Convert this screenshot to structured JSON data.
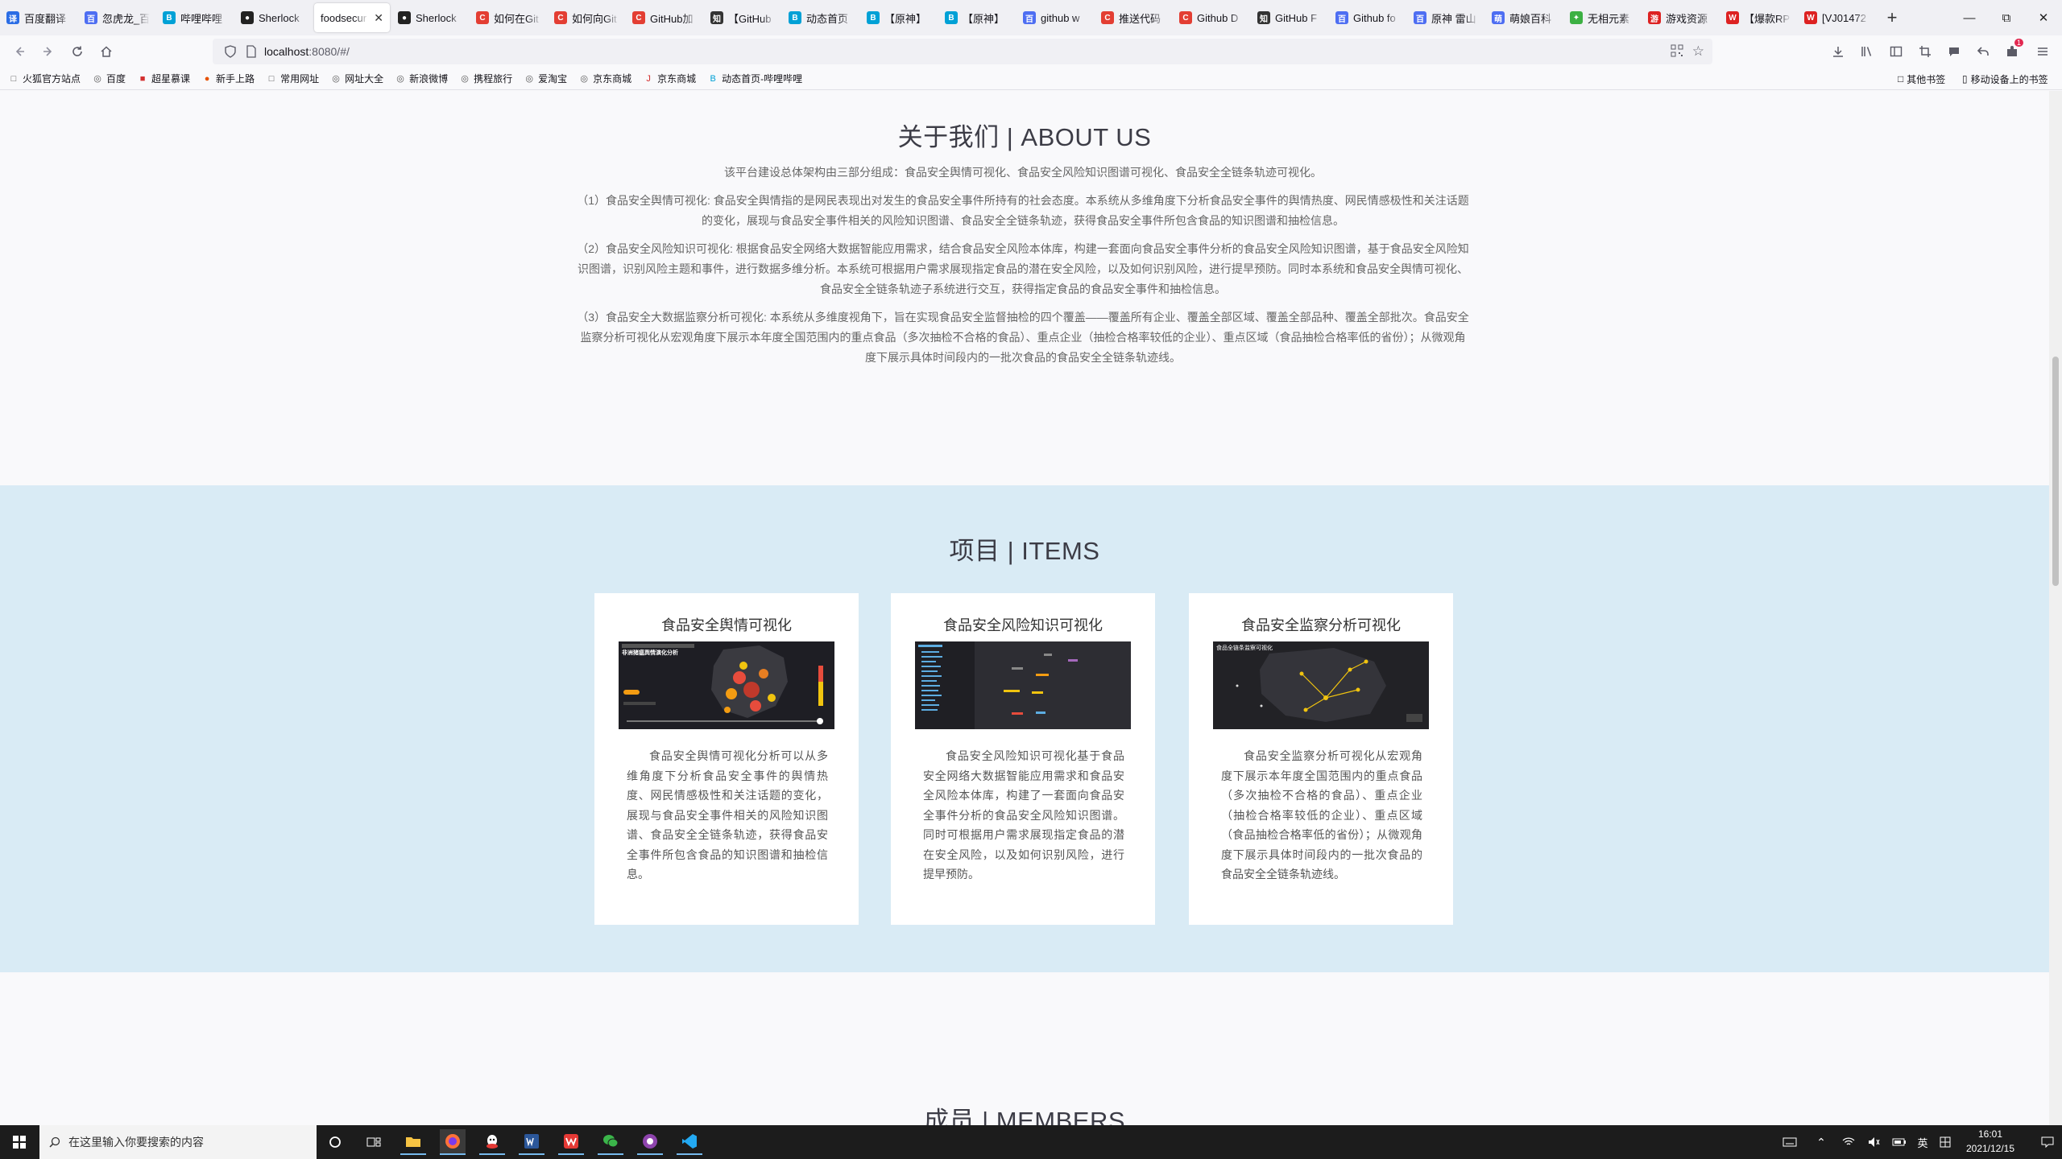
{
  "browser": {
    "tabs": [
      {
        "title": "百度翻译",
        "favicon_color": "#2b6de5",
        "glyph": "译"
      },
      {
        "title": "忽虎龙_百",
        "favicon_color": "#4e6ef2",
        "glyph": "百"
      },
      {
        "title": "哔哩哔哩",
        "favicon_color": "#00a1d6",
        "glyph": "B"
      },
      {
        "title": "Sherlock",
        "favicon_color": "#222222",
        "glyph": "●"
      },
      {
        "title": "foodsecur",
        "favicon_color": "#ffffff",
        "glyph": ""
      },
      {
        "title": "Sherlock",
        "favicon_color": "#222222",
        "glyph": "●"
      },
      {
        "title": "如何在Git",
        "favicon_color": "#e33e33",
        "glyph": "C"
      },
      {
        "title": "如何向Git",
        "favicon_color": "#e33e33",
        "glyph": "C"
      },
      {
        "title": "GitHub加",
        "favicon_color": "#e33e33",
        "glyph": "C"
      },
      {
        "title": "【GitHub",
        "favicon_color": "#333333",
        "glyph": "知"
      },
      {
        "title": "动态首页",
        "favicon_color": "#00a1d6",
        "glyph": "B"
      },
      {
        "title": "【原神】",
        "favicon_color": "#00a1d6",
        "glyph": "B"
      },
      {
        "title": "【原神】",
        "favicon_color": "#00a1d6",
        "glyph": "B"
      },
      {
        "title": "github w",
        "favicon_color": "#4e6ef2",
        "glyph": "百"
      },
      {
        "title": "推送代码",
        "favicon_color": "#e33e33",
        "glyph": "C"
      },
      {
        "title": "Github D",
        "favicon_color": "#e33e33",
        "glyph": "C"
      },
      {
        "title": "GitHub F",
        "favicon_color": "#333333",
        "glyph": "知"
      },
      {
        "title": "Github fo",
        "favicon_color": "#4e6ef2",
        "glyph": "百"
      },
      {
        "title": "原神 雷山",
        "favicon_color": "#4e6ef2",
        "glyph": "百"
      },
      {
        "title": "萌娘百科",
        "favicon_color": "#4e6ef2",
        "glyph": "萌"
      },
      {
        "title": "无相元素",
        "favicon_color": "#3cb043",
        "glyph": "✦"
      },
      {
        "title": "游戏资源",
        "favicon_color": "#d22",
        "glyph": "游"
      },
      {
        "title": "【爆款RP",
        "favicon_color": "#d22",
        "glyph": "W"
      },
      {
        "title": "[VJ01472",
        "favicon_color": "#d22",
        "glyph": "W"
      }
    ],
    "url_host": "localhost",
    "url_path": ":8080/#/",
    "bookmarks": [
      "火狐官方站点",
      "百度",
      "超星慕课",
      "新手上路",
      "常用网址",
      "网址大全",
      "新浪微博",
      "携程旅行",
      "爱淘宝",
      "京东商城",
      "京东商城",
      "动态首页-哔哩哔哩"
    ],
    "bookmarks_right": [
      "其他书签",
      "移动设备上的书签"
    ],
    "notification_badge": "1"
  },
  "about": {
    "title": "关于我们 | ABOUT US",
    "intro": "该平台建设总体架构由三部分组成：食品安全舆情可视化、食品安全风险知识图谱可视化、食品安全全链条轨迹可视化。",
    "p1": "（1）食品安全舆情可视化: 食品安全舆情指的是网民表现出对发生的食品安全事件所持有的社会态度。本系统从多维角度下分析食品安全事件的舆情热度、网民情感极性和关注话题的变化，展现与食品安全事件相关的风险知识图谱、食品安全全链条轨迹，获得食品安全事件所包含食品的知识图谱和抽检信息。",
    "p2": "（2）食品安全风险知识可视化: 根据食品安全网络大数据智能应用需求，结合食品安全风险本体库，构建一套面向食品安全事件分析的食品安全风险知识图谱，基于食品安全风险知识图谱，识别风险主题和事件，进行数据多维分析。本系统可根据用户需求展现指定食品的潜在安全风险，以及如何识别风险，进行提早预防。同时本系统和食品安全舆情可视化、食品安全全链条轨迹子系统进行交互，获得指定食品的食品安全事件和抽检信息。",
    "p3": "（3）食品安全大数据监察分析可视化: 本系统从多维度视角下，旨在实现食品安全监督抽检的四个覆盖——覆盖所有企业、覆盖全部区域、覆盖全部品种、覆盖全部批次。食品安全监察分析可视化从宏观角度下展示本年度全国范围内的重点食品（多次抽检不合格的食品）、重点企业（抽检合格率较低的企业）、重点区域（食品抽检合格率低的省份）；从微观角度下展示具体时间段内的一批次食品的食品安全全链条轨迹线。"
  },
  "items": {
    "title": "项目 | ITEMS",
    "cards": [
      {
        "title": "食品安全舆情可视化",
        "thumb_heading": "非洲猪瘟舆情演化分析",
        "desc": "食品安全舆情可视化分析可以从多维角度下分析食品安全事件的舆情热度、网民情感极性和关注话题的变化，展现与食品安全事件相关的风险知识图谱、食品安全全链条轨迹，获得食品安全事件所包含食品的知识图谱和抽检信息。"
      },
      {
        "title": "食品安全风险知识可视化",
        "thumb_heading": "",
        "desc": "食品安全风险知识可视化基于食品安全网络大数据智能应用需求和食品安全风险本体库，构建了一套面向食品安全事件分析的食品安全风险知识图谱。同时可根据用户需求展现指定食品的潜在安全风险，以及如何识别风险，进行提早预防。"
      },
      {
        "title": "食品安全监察分析可视化",
        "thumb_heading": "食品全链条监察可视化",
        "desc": "食品安全监察分析可视化从宏观角度下展示本年度全国范围内的重点食品（多次抽检不合格的食品）、重点企业（抽检合格率较低的企业）、重点区域（食品抽检合格率低的省份）；从微观角度下展示具体时间段内的一批次食品的食品安全全链条轨迹线。"
      }
    ]
  },
  "members": {
    "title": "成员 | MEMBERS"
  },
  "taskbar": {
    "search_placeholder": "在这里输入你要搜索的内容",
    "time": "16:01",
    "date": "2021/12/15",
    "ime_lang": "英"
  },
  "colors": {
    "items_bg": "#d9ebf5",
    "heading": "#3c3c46",
    "body_text": "#666666"
  }
}
